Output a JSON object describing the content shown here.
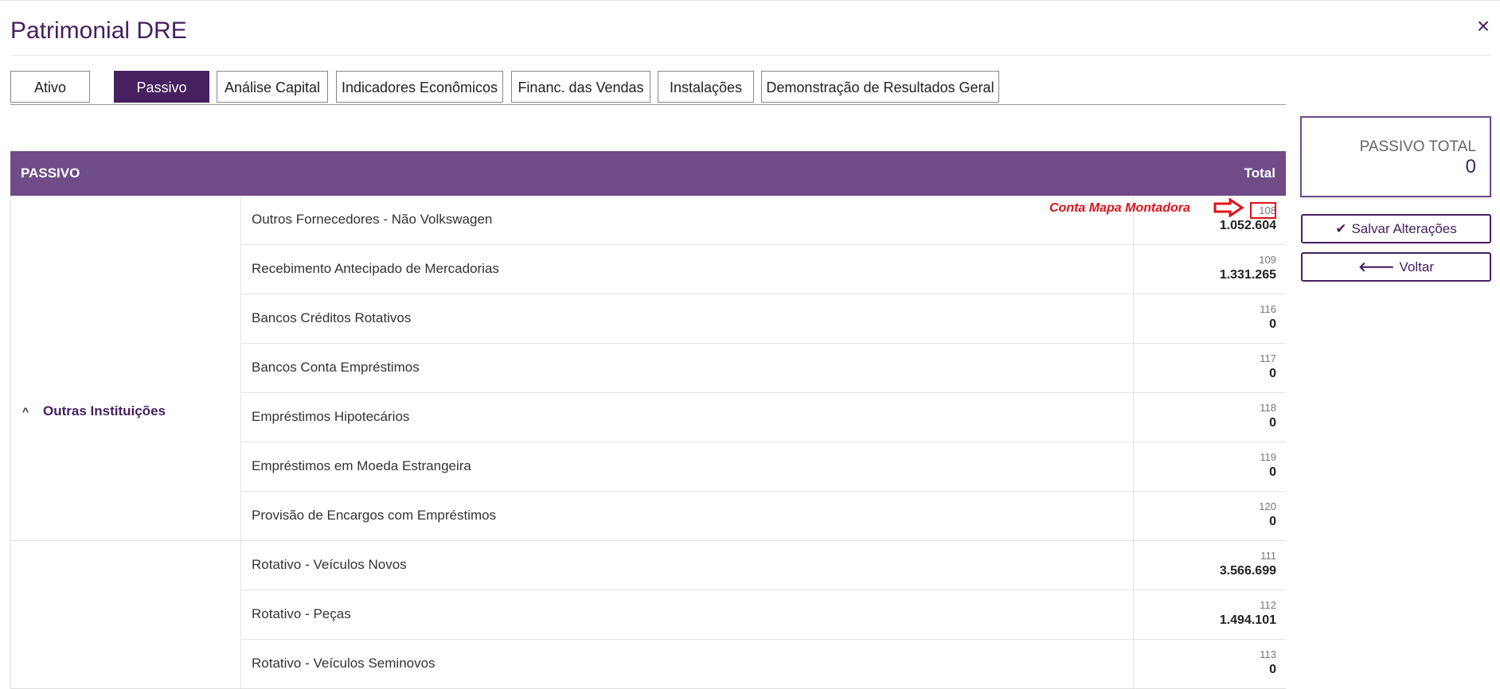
{
  "modal": {
    "title": "Patrimonial DRE",
    "close_icon": "×"
  },
  "tabs": [
    {
      "label": "Ativo",
      "active": false
    },
    {
      "label": "Passivo",
      "active": true
    },
    {
      "label": "Análise Capital",
      "active": false
    },
    {
      "label": "Indicadores Econômicos",
      "active": false
    },
    {
      "label": "Financ. das Vendas",
      "active": false
    },
    {
      "label": "Instalações",
      "active": false
    },
    {
      "label": "Demonstração de Resultados Geral",
      "active": false
    }
  ],
  "table": {
    "header_left": "PASSIVO",
    "header_right": "Total",
    "groups": [
      {
        "label": "Outras Instituições",
        "expanded": true,
        "rows": [
          {
            "label": "Outros Fornecedores - Não Volkswagen",
            "code": "108",
            "value": "1.052.604"
          },
          {
            "label": "Recebimento Antecipado de Mercadorias",
            "code": "109",
            "value": "1.331.265"
          },
          {
            "label": "Bancos Créditos Rotativos",
            "code": "116",
            "value": "0"
          },
          {
            "label": "Bancos Conta Empréstimos",
            "code": "117",
            "value": "0"
          },
          {
            "label": "Empréstimos Hipotecários",
            "code": "118",
            "value": "0"
          },
          {
            "label": "Empréstimos em Moeda Estrangeira",
            "code": "119",
            "value": "0"
          },
          {
            "label": "Provisão de Encargos com Empréstimos",
            "code": "120",
            "value": "0"
          }
        ]
      },
      {
        "label": "",
        "expanded": true,
        "rows": [
          {
            "label": "Rotativo - Veículos Novos",
            "code": "111",
            "value": "3.566.699"
          },
          {
            "label": "Rotativo - Peças",
            "code": "112",
            "value": "1.494.101"
          },
          {
            "label": "Rotativo - Veículos Seminovos",
            "code": "113",
            "value": "0"
          }
        ]
      }
    ]
  },
  "annotation": {
    "text": "Conta Mapa Montadora",
    "color": "#e0101a"
  },
  "sidebar": {
    "total_label": "PASSIVO TOTAL",
    "total_value": "0",
    "save_label": "Salvar Alterações",
    "back_label": "Voltar"
  },
  "colors": {
    "primary": "#46205f",
    "header_bg": "#6f4b88",
    "accent_red": "#e0101a"
  }
}
